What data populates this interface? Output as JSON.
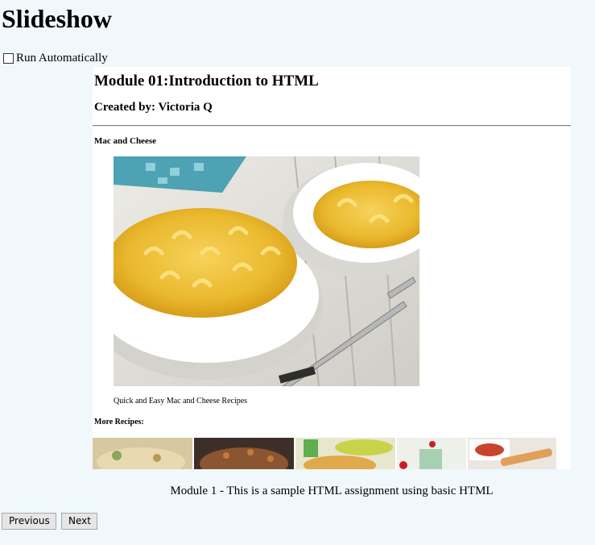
{
  "page": {
    "title": "Slideshow",
    "run_auto_label": "Run Automatically",
    "run_auto_checked": false
  },
  "slide": {
    "module_title": "Module 01:Introduction to HTML",
    "created_by": "Created by: Victoria Q",
    "recipe_title": "Mac and Cheese",
    "hero_caption": "Quick and Easy Mac and Cheese Recipes",
    "more_title": "More Recipes:"
  },
  "footer": {
    "text": "Module 1 - This is a sample HTML assignment using basic HTML"
  },
  "nav": {
    "previous_label": "Previous",
    "next_label": "Next"
  },
  "colors": {
    "page_bg": "#f0f8fb",
    "frame_bg": "#ffffff",
    "button_bg": "#e6e6e6"
  }
}
